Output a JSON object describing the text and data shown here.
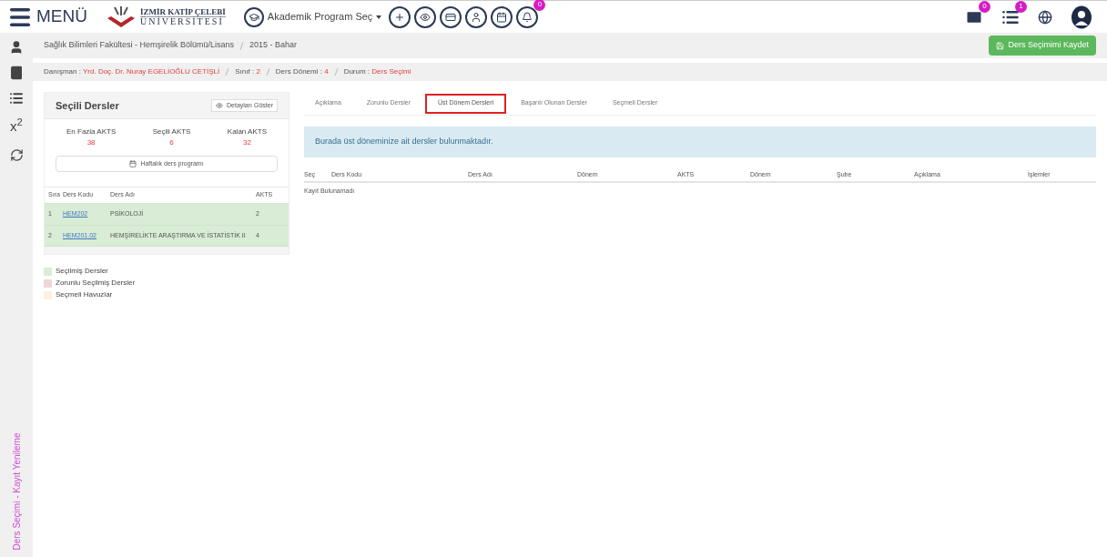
{
  "header": {
    "menu_label": "MENÜ",
    "logo_line1": "İZMİR KATİP ÇELEBİ",
    "logo_line2": "ÜNİVERSİTESİ",
    "program_select": "Akademik Program Seç",
    "bell_badge": "0",
    "mail_badge": "0",
    "list_badge": "1"
  },
  "sidebar": {
    "superscript_label": "x$^{2}$",
    "vertical_title": "Ders Seçimi - Kayıt Yenileme"
  },
  "breadcrumb": [
    "Sağlık Bilimleri Fakültesi - Hemşirelik Bölümü/Lisans",
    "2015 - Bahar"
  ],
  "save_button": "Ders Seçimimi Kaydet",
  "info_bar": [
    {
      "label": "Danışman : ",
      "value": "Yrd. Doç. Dr. Nuray EGELİOĞLU CETİŞLİ"
    },
    {
      "label": "Sınıf : ",
      "value": "2"
    },
    {
      "label": "Ders Dönemi : ",
      "value": "4"
    },
    {
      "label": "Durum : ",
      "value": "Ders Seçimi"
    }
  ],
  "selected_panel": {
    "title": "Seçili Dersler",
    "details_button": "Detayları Göster",
    "stats": [
      {
        "label": "En Fazla AKTS",
        "value": "38"
      },
      {
        "label": "Seçili AKTS",
        "value": "6"
      },
      {
        "label": "Kalan AKTS",
        "value": "32"
      }
    ],
    "weekly_button": "Haftalık ders programı",
    "columns": [
      "Sıra",
      "Ders Kodu",
      "Ders Adı",
      "AKTS"
    ],
    "rows": [
      {
        "no": "1",
        "code": "HEM202",
        "name": "PSİKOLOJİ",
        "akts": "2"
      },
      {
        "no": "2",
        "code": "HEM201.02",
        "name": "HEMŞİRELİKTE ARAŞTIRMA VE İSTATİSTİK II",
        "akts": "4"
      }
    ]
  },
  "legend": [
    {
      "label": "Seçilmiş Dersler",
      "color": "#d9ecd6"
    },
    {
      "label": "Zorunlu Seçilmiş Dersler",
      "color": "#f2d4da"
    },
    {
      "label": "Seçmeli Havuzlar",
      "color": "#fcf2da"
    }
  ],
  "tabs": [
    {
      "label": "Açıklama",
      "selected": false
    },
    {
      "label": "Zorunlu Dersler",
      "selected": false
    },
    {
      "label": "Üst Dönem Dersleri",
      "selected": true
    },
    {
      "label": "Başarılı Olunan Dersler",
      "selected": false
    },
    {
      "label": "Seçmeli Dersler",
      "selected": false
    }
  ],
  "info_message": "Burada üst döneminize ait dersler bulunmaktadır.",
  "table": {
    "columns": [
      "Seç",
      "Ders Kodu",
      "Ders Adı",
      "Dönem",
      "AKTS",
      "Dönem",
      "Şube",
      "Açıklama",
      "İşlemler"
    ],
    "empty_text": "Kayıt Bulunamadı"
  }
}
